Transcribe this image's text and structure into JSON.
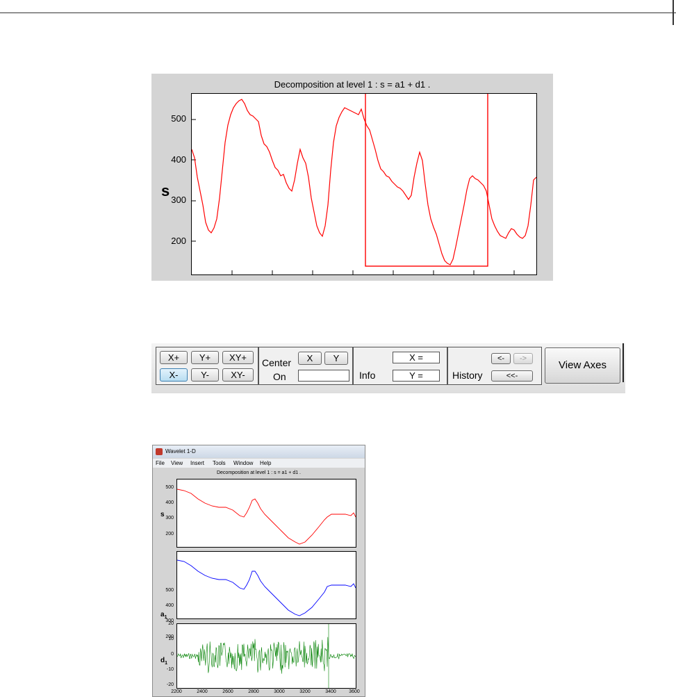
{
  "figure1": {
    "title": "Decomposition at level 1 : s = a1 + d1 .",
    "ylabel": "s",
    "yticks": [
      "500",
      "400",
      "300",
      "200"
    ],
    "signal_color": "#ff0000",
    "zoom_rect_color": "#ff0000"
  },
  "toolbar": {
    "x_plus": "X+",
    "y_plus": "Y+",
    "xy_plus": "XY+",
    "x_minus": "X-",
    "y_minus": "Y-",
    "xy_minus": "XY-",
    "center_label": "Center",
    "on_label": "On",
    "center_x": "X",
    "center_y": "Y",
    "info_label": "Info",
    "info_x": "X =",
    "info_y": "Y =",
    "history_label": "History",
    "hist_back": "<-",
    "hist_fwd": "->",
    "hist_first": "<<-",
    "view_axes": "View Axes"
  },
  "window": {
    "title": "Wavelet 1-D",
    "menu": [
      "File",
      "View",
      "Insert",
      "Tools",
      "Window",
      "Help"
    ],
    "plot_title": "Decomposition at level 1 : s = a1 + d1 .",
    "subplots": [
      {
        "label": "s",
        "sub": "",
        "yticks": [
          "500",
          "400",
          "300",
          "200"
        ],
        "color": "#ff0000"
      },
      {
        "label": "a",
        "sub": "1",
        "yticks": [
          "500",
          "400",
          "300",
          "200"
        ],
        "color": "#0000ff"
      },
      {
        "label": "d",
        "sub": "1",
        "yticks": [
          "20",
          "10",
          "0",
          "-10",
          "-20"
        ],
        "color": "#008000"
      }
    ],
    "xticks": [
      "2200",
      "2400",
      "2600",
      "2800",
      "3000",
      "3200",
      "3400",
      "3600"
    ]
  }
}
